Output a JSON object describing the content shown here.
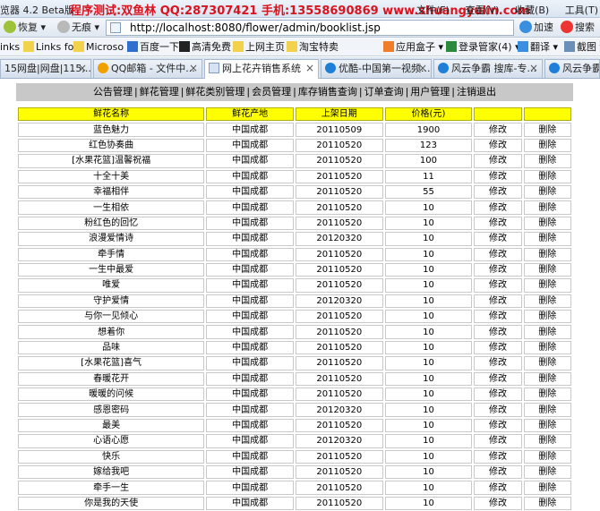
{
  "window": {
    "app_title": "览器 4.2 Beta版",
    "watermark": "程序测试:双鱼林 QQ:287307421 手机:13558690869 www.shuangyulin.com",
    "menu": [
      "文件(F)",
      "查看(V)",
      "收藏(B)",
      "工具(T)"
    ]
  },
  "nav": {
    "back_label": "恢复",
    "no_history_label": "无痕",
    "address": "http://localhost:8080/flower/admin/booklist.jsp",
    "accelerate_label": "加速",
    "search_label": "搜索"
  },
  "favorites": [
    "inks",
    "Links fo",
    "Microso",
    "百度一下",
    "高清免费",
    "上网主页",
    "淘宝特卖",
    "应用盒子",
    "登录管家(4)",
    "翻译",
    "截图"
  ],
  "tabs": [
    {
      "label": "15网盘|网盘|115,..."
    },
    {
      "label": "QQ邮箱 - 文件中..."
    },
    {
      "label": "网上花卉销售系统"
    },
    {
      "label": "优酷-中国第一视频..."
    },
    {
      "label": "风云争霸 搜库-专..."
    },
    {
      "label": "风云争霸"
    }
  ],
  "site_nav": [
    "公告管理",
    "鲜花管理",
    "鲜花类别管理",
    "会员管理",
    "库存销售查询",
    "订单查询",
    "用户管理",
    "注销退出"
  ],
  "table": {
    "headers": [
      "鲜花名称",
      "鲜花产地",
      "上架日期",
      "价格(元)",
      "",
      ""
    ],
    "edit_label": "修改",
    "delete_label": "删除",
    "rows": [
      {
        "name": "蓝色魅力",
        "origin": "中国成都",
        "date": "20110509",
        "price": "1900"
      },
      {
        "name": "红色协奏曲",
        "origin": "中国成都",
        "date": "20110520",
        "price": "123"
      },
      {
        "name": "[水果花篮]温馨祝福",
        "origin": "中国成都",
        "date": "20110520",
        "price": "100"
      },
      {
        "name": "十全十美",
        "origin": "中国成都",
        "date": "20110520",
        "price": "11"
      },
      {
        "name": "幸福相伴",
        "origin": "中国成都",
        "date": "20110520",
        "price": "55"
      },
      {
        "name": "一生相依",
        "origin": "中国成都",
        "date": "20110520",
        "price": "10"
      },
      {
        "name": "粉红色的回忆",
        "origin": "中国成都",
        "date": "20110520",
        "price": "10"
      },
      {
        "name": "浪漫爱情诗",
        "origin": "中国成都",
        "date": "20120320",
        "price": "10"
      },
      {
        "name": "牵手情",
        "origin": "中国成都",
        "date": "20110520",
        "price": "10"
      },
      {
        "name": "一生中最爱",
        "origin": "中国成都",
        "date": "20110520",
        "price": "10"
      },
      {
        "name": "唯爱",
        "origin": "中国成都",
        "date": "20110520",
        "price": "10"
      },
      {
        "name": "守护爱情",
        "origin": "中国成都",
        "date": "20120320",
        "price": "10"
      },
      {
        "name": "与你一见倾心",
        "origin": "中国成都",
        "date": "20110520",
        "price": "10"
      },
      {
        "name": "想着你",
        "origin": "中国成都",
        "date": "20110520",
        "price": "10"
      },
      {
        "name": "品味",
        "origin": "中国成都",
        "date": "20110520",
        "price": "10"
      },
      {
        "name": "[水果花篮]喜气",
        "origin": "中国成都",
        "date": "20110520",
        "price": "10"
      },
      {
        "name": "春暖花开",
        "origin": "中国成都",
        "date": "20110520",
        "price": "10"
      },
      {
        "name": "暖暖的问候",
        "origin": "中国成都",
        "date": "20110520",
        "price": "10"
      },
      {
        "name": "感恩密码",
        "origin": "中国成都",
        "date": "20120320",
        "price": "10"
      },
      {
        "name": "最美",
        "origin": "中国成都",
        "date": "20110520",
        "price": "10"
      },
      {
        "name": "心语心愿",
        "origin": "中国成都",
        "date": "20120320",
        "price": "10"
      },
      {
        "name": "快乐",
        "origin": "中国成都",
        "date": "20110520",
        "price": "10"
      },
      {
        "name": "嫁给我吧",
        "origin": "中国成都",
        "date": "20110520",
        "price": "10"
      },
      {
        "name": "牵手一生",
        "origin": "中国成都",
        "date": "20110520",
        "price": "10"
      },
      {
        "name": "你是我的天使",
        "origin": "中国成都",
        "date": "20110520",
        "price": "10"
      }
    ]
  }
}
